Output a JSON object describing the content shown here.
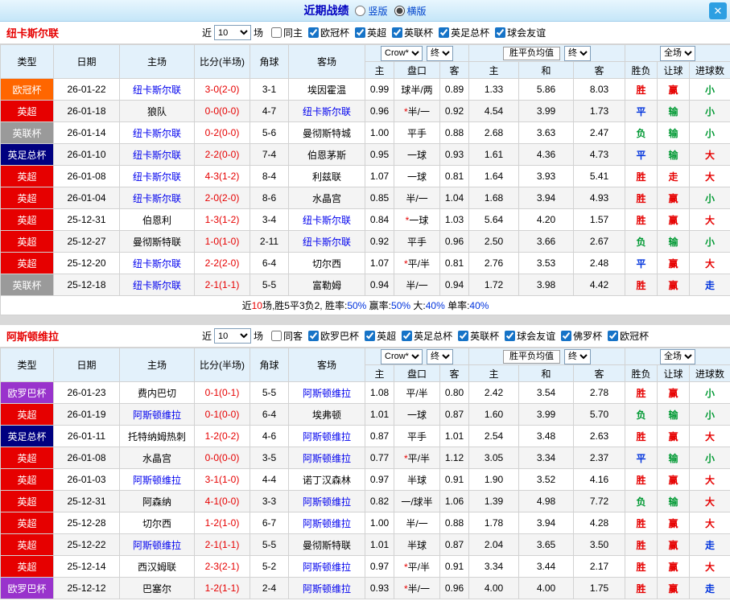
{
  "topbar": {
    "title": "近期战绩",
    "layout_options": [
      {
        "label": "竖版",
        "selected": false
      },
      {
        "label": "横版",
        "selected": true
      }
    ],
    "close": "✕"
  },
  "table_headers": {
    "type": "类型",
    "date": "日期",
    "home": "主场",
    "score": "比分(半场)",
    "corner": "角球",
    "away": "客场",
    "odds_home": "主",
    "handicap": "盘口",
    "odds_away": "客",
    "avg_win": "主",
    "avg_draw": "和",
    "avg_lose": "客",
    "result": "胜负",
    "handicap_result": "让球",
    "goals_result": "进球数"
  },
  "controls": {
    "odds_source": "Crow*",
    "final_label": "终",
    "avg_label": "胜平负均值",
    "scope": "全场"
  },
  "league_colors": {
    "欧冠杯": "#ff6600",
    "英超": "#e60000",
    "英联杯": "#9a9a9a",
    "英足总杯": "#000080",
    "欧罗巴杯": "#9933cc"
  },
  "result_palette": {
    "red": "#e60000",
    "blue": "#0033dd",
    "green": "#009933"
  },
  "sections": [
    {
      "team": "纽卡斯尔联",
      "team_color": "#e60000",
      "filter": {
        "near_label": "近",
        "match_count": "10",
        "games_label": "场",
        "same_label": "同主",
        "same_checked": false,
        "leagues": [
          "欧冠杯",
          "英超",
          "英联杯",
          "英足总杯",
          "球会友谊"
        ]
      },
      "rows": [
        {
          "league": "欧冠杯",
          "date": "26-01-22",
          "home": "纽卡斯尔联",
          "home_is_team": true,
          "score": "3-0(2-0)",
          "corner": "3-1",
          "away": "埃因霍温",
          "away_is_team": false,
          "odds_home": "0.99",
          "handicap": "球半/两",
          "odds_away": "0.89",
          "avg_win": "1.33",
          "avg_draw": "5.86",
          "avg_lose": "8.03",
          "result": {
            "t": "胜",
            "c": "red"
          },
          "handicap_result": {
            "t": "赢",
            "c": "red"
          },
          "goals_result": {
            "t": "小",
            "c": "green"
          }
        },
        {
          "league": "英超",
          "date": "26-01-18",
          "home": "狼队",
          "home_is_team": false,
          "score": "0-0(0-0)",
          "corner": "4-7",
          "away": "纽卡斯尔联",
          "away_is_team": true,
          "odds_home": "0.96",
          "handicap": "*半/一",
          "odds_away": "0.92",
          "avg_win": "4.54",
          "avg_draw": "3.99",
          "avg_lose": "1.73",
          "result": {
            "t": "平",
            "c": "blue"
          },
          "handicap_result": {
            "t": "输",
            "c": "green"
          },
          "goals_result": {
            "t": "小",
            "c": "green"
          }
        },
        {
          "league": "英联杯",
          "date": "26-01-14",
          "home": "纽卡斯尔联",
          "home_is_team": true,
          "score": "0-2(0-0)",
          "corner": "5-6",
          "away": "曼彻斯特城",
          "away_is_team": false,
          "odds_home": "1.00",
          "handicap": "平手",
          "odds_away": "0.88",
          "avg_win": "2.68",
          "avg_draw": "3.63",
          "avg_lose": "2.47",
          "result": {
            "t": "负",
            "c": "green"
          },
          "handicap_result": {
            "t": "输",
            "c": "green"
          },
          "goals_result": {
            "t": "小",
            "c": "green"
          }
        },
        {
          "league": "英足总杯",
          "date": "26-01-10",
          "home": "纽卡斯尔联",
          "home_is_team": true,
          "score": "2-2(0-0)",
          "corner": "7-4",
          "away": "伯恩茅斯",
          "away_is_team": false,
          "odds_home": "0.95",
          "handicap": "一球",
          "odds_away": "0.93",
          "avg_win": "1.61",
          "avg_draw": "4.36",
          "avg_lose": "4.73",
          "result": {
            "t": "平",
            "c": "blue"
          },
          "handicap_result": {
            "t": "输",
            "c": "green"
          },
          "goals_result": {
            "t": "大",
            "c": "red"
          }
        },
        {
          "league": "英超",
          "date": "26-01-08",
          "home": "纽卡斯尔联",
          "home_is_team": true,
          "score": "4-3(1-2)",
          "corner": "8-4",
          "away": "利兹联",
          "away_is_team": false,
          "odds_home": "1.07",
          "handicap": "一球",
          "odds_away": "0.81",
          "avg_win": "1.64",
          "avg_draw": "3.93",
          "avg_lose": "5.41",
          "result": {
            "t": "胜",
            "c": "red"
          },
          "handicap_result": {
            "t": "走",
            "c": "red"
          },
          "goals_result": {
            "t": "大",
            "c": "red"
          }
        },
        {
          "league": "英超",
          "date": "26-01-04",
          "home": "纽卡斯尔联",
          "home_is_team": true,
          "score": "2-0(2-0)",
          "corner": "8-6",
          "away": "水晶宫",
          "away_is_team": false,
          "odds_home": "0.85",
          "handicap": "半/一",
          "odds_away": "1.04",
          "avg_win": "1.68",
          "avg_draw": "3.94",
          "avg_lose": "4.93",
          "result": {
            "t": "胜",
            "c": "red"
          },
          "handicap_result": {
            "t": "赢",
            "c": "red"
          },
          "goals_result": {
            "t": "小",
            "c": "green"
          }
        },
        {
          "league": "英超",
          "date": "25-12-31",
          "home": "伯恩利",
          "home_is_team": false,
          "score": "1-3(1-2)",
          "corner": "3-4",
          "away": "纽卡斯尔联",
          "away_is_team": true,
          "odds_home": "0.84",
          "handicap": "*一球",
          "odds_away": "1.03",
          "avg_win": "5.64",
          "avg_draw": "4.20",
          "avg_lose": "1.57",
          "result": {
            "t": "胜",
            "c": "red"
          },
          "handicap_result": {
            "t": "赢",
            "c": "red"
          },
          "goals_result": {
            "t": "大",
            "c": "red"
          }
        },
        {
          "league": "英超",
          "date": "25-12-27",
          "home": "曼彻斯特联",
          "home_is_team": false,
          "score": "1-0(1-0)",
          "corner": "2-11",
          "away": "纽卡斯尔联",
          "away_is_team": true,
          "odds_home": "0.92",
          "handicap": "平手",
          "odds_away": "0.96",
          "avg_win": "2.50",
          "avg_draw": "3.66",
          "avg_lose": "2.67",
          "result": {
            "t": "负",
            "c": "green"
          },
          "handicap_result": {
            "t": "输",
            "c": "green"
          },
          "goals_result": {
            "t": "小",
            "c": "green"
          }
        },
        {
          "league": "英超",
          "date": "25-12-20",
          "home": "纽卡斯尔联",
          "home_is_team": true,
          "score": "2-2(2-0)",
          "corner": "6-4",
          "away": "切尔西",
          "away_is_team": false,
          "odds_home": "1.07",
          "handicap": "*平/半",
          "odds_away": "0.81",
          "avg_win": "2.76",
          "avg_draw": "3.53",
          "avg_lose": "2.48",
          "result": {
            "t": "平",
            "c": "blue"
          },
          "handicap_result": {
            "t": "赢",
            "c": "red"
          },
          "goals_result": {
            "t": "大",
            "c": "red"
          }
        },
        {
          "league": "英联杯",
          "date": "25-12-18",
          "home": "纽卡斯尔联",
          "home_is_team": true,
          "score": "2-1(1-1)",
          "corner": "5-5",
          "away": "富勒姆",
          "away_is_team": false,
          "odds_home": "0.94",
          "handicap": "半/一",
          "odds_away": "0.94",
          "avg_win": "1.72",
          "avg_draw": "3.98",
          "avg_lose": "4.42",
          "result": {
            "t": "胜",
            "c": "red"
          },
          "handicap_result": {
            "t": "赢",
            "c": "red"
          },
          "goals_result": {
            "t": "走",
            "c": "blue"
          }
        }
      ],
      "summary": [
        {
          "t": "近",
          "c": "k"
        },
        {
          "t": "10",
          "c": "r"
        },
        {
          "t": "场,胜5平3负2, 胜率:",
          "c": "k"
        },
        {
          "t": "50%",
          "c": "b"
        },
        {
          "t": " 赢率:",
          "c": "k"
        },
        {
          "t": "50%",
          "c": "b"
        },
        {
          "t": " 大:",
          "c": "k"
        },
        {
          "t": "40%",
          "c": "b"
        },
        {
          "t": " 单率:",
          "c": "k"
        },
        {
          "t": "40%",
          "c": "b"
        }
      ]
    },
    {
      "team": "阿斯顿维拉",
      "team_color": "#e60000",
      "filter": {
        "near_label": "近",
        "match_count": "10",
        "games_label": "场",
        "same_label": "同客",
        "same_checked": false,
        "leagues": [
          "欧罗巴杯",
          "英超",
          "英足总杯",
          "英联杯",
          "球会友谊",
          "佛罗杯",
          "欧冠杯"
        ]
      },
      "rows": [
        {
          "league": "欧罗巴杯",
          "date": "26-01-23",
          "home": "费内巴切",
          "home_is_team": false,
          "score": "0-1(0-1)",
          "corner": "5-5",
          "away": "阿斯顿维拉",
          "away_is_team": true,
          "odds_home": "1.08",
          "handicap": "平/半",
          "odds_away": "0.80",
          "avg_win": "2.42",
          "avg_draw": "3.54",
          "avg_lose": "2.78",
          "result": {
            "t": "胜",
            "c": "red"
          },
          "handicap_result": {
            "t": "赢",
            "c": "red"
          },
          "goals_result": {
            "t": "小",
            "c": "green"
          }
        },
        {
          "league": "英超",
          "date": "26-01-19",
          "home": "阿斯顿维拉",
          "home_is_team": true,
          "score": "0-1(0-0)",
          "corner": "6-4",
          "away": "埃弗顿",
          "away_is_team": false,
          "odds_home": "1.01",
          "handicap": "一球",
          "odds_away": "0.87",
          "avg_win": "1.60",
          "avg_draw": "3.99",
          "avg_lose": "5.70",
          "result": {
            "t": "负",
            "c": "green"
          },
          "handicap_result": {
            "t": "输",
            "c": "green"
          },
          "goals_result": {
            "t": "小",
            "c": "green"
          }
        },
        {
          "league": "英足总杯",
          "date": "26-01-11",
          "home": "托特纳姆热刺",
          "home_is_team": false,
          "score": "1-2(0-2)",
          "corner": "4-6",
          "away": "阿斯顿维拉",
          "away_is_team": true,
          "odds_home": "0.87",
          "handicap": "平手",
          "odds_away": "1.01",
          "avg_win": "2.54",
          "avg_draw": "3.48",
          "avg_lose": "2.63",
          "result": {
            "t": "胜",
            "c": "red"
          },
          "handicap_result": {
            "t": "赢",
            "c": "red"
          },
          "goals_result": {
            "t": "大",
            "c": "red"
          }
        },
        {
          "league": "英超",
          "date": "26-01-08",
          "home": "水晶宫",
          "home_is_team": false,
          "score": "0-0(0-0)",
          "corner": "3-5",
          "away": "阿斯顿维拉",
          "away_is_team": true,
          "odds_home": "0.77",
          "handicap": "*平/半",
          "odds_away": "1.12",
          "avg_win": "3.05",
          "avg_draw": "3.34",
          "avg_lose": "2.37",
          "result": {
            "t": "平",
            "c": "blue"
          },
          "handicap_result": {
            "t": "输",
            "c": "green"
          },
          "goals_result": {
            "t": "小",
            "c": "green"
          }
        },
        {
          "league": "英超",
          "date": "26-01-03",
          "home": "阿斯顿维拉",
          "home_is_team": true,
          "score": "3-1(1-0)",
          "corner": "4-4",
          "away": "诺丁汉森林",
          "away_is_team": false,
          "odds_home": "0.97",
          "handicap": "半球",
          "odds_away": "0.91",
          "avg_win": "1.90",
          "avg_draw": "3.52",
          "avg_lose": "4.16",
          "result": {
            "t": "胜",
            "c": "red"
          },
          "handicap_result": {
            "t": "赢",
            "c": "red"
          },
          "goals_result": {
            "t": "大",
            "c": "red"
          }
        },
        {
          "league": "英超",
          "date": "25-12-31",
          "home": "阿森纳",
          "home_is_team": false,
          "score": "4-1(0-0)",
          "corner": "3-3",
          "away": "阿斯顿维拉",
          "away_is_team": true,
          "odds_home": "0.82",
          "handicap": "一/球半",
          "odds_away": "1.06",
          "avg_win": "1.39",
          "avg_draw": "4.98",
          "avg_lose": "7.72",
          "result": {
            "t": "负",
            "c": "green"
          },
          "handicap_result": {
            "t": "输",
            "c": "green"
          },
          "goals_result": {
            "t": "大",
            "c": "red"
          }
        },
        {
          "league": "英超",
          "date": "25-12-28",
          "home": "切尔西",
          "home_is_team": false,
          "score": "1-2(1-0)",
          "corner": "6-7",
          "away": "阿斯顿维拉",
          "away_is_team": true,
          "odds_home": "1.00",
          "handicap": "半/一",
          "odds_away": "0.88",
          "avg_win": "1.78",
          "avg_draw": "3.94",
          "avg_lose": "4.28",
          "result": {
            "t": "胜",
            "c": "red"
          },
          "handicap_result": {
            "t": "赢",
            "c": "red"
          },
          "goals_result": {
            "t": "大",
            "c": "red"
          }
        },
        {
          "league": "英超",
          "date": "25-12-22",
          "home": "阿斯顿维拉",
          "home_is_team": true,
          "score": "2-1(1-1)",
          "corner": "5-5",
          "away": "曼彻斯特联",
          "away_is_team": false,
          "odds_home": "1.01",
          "handicap": "半球",
          "odds_away": "0.87",
          "avg_win": "2.04",
          "avg_draw": "3.65",
          "avg_lose": "3.50",
          "result": {
            "t": "胜",
            "c": "red"
          },
          "handicap_result": {
            "t": "赢",
            "c": "red"
          },
          "goals_result": {
            "t": "走",
            "c": "blue"
          }
        },
        {
          "league": "英超",
          "date": "25-12-14",
          "home": "西汉姆联",
          "home_is_team": false,
          "score": "2-3(2-1)",
          "corner": "5-2",
          "away": "阿斯顿维拉",
          "away_is_team": true,
          "odds_home": "0.97",
          "handicap": "*平/半",
          "odds_away": "0.91",
          "avg_win": "3.34",
          "avg_draw": "3.44",
          "avg_lose": "2.17",
          "result": {
            "t": "胜",
            "c": "red"
          },
          "handicap_result": {
            "t": "赢",
            "c": "red"
          },
          "goals_result": {
            "t": "大",
            "c": "red"
          }
        },
        {
          "league": "欧罗巴杯",
          "date": "25-12-12",
          "home": "巴塞尔",
          "home_is_team": false,
          "score": "1-2(1-1)",
          "corner": "2-4",
          "away": "阿斯顿维拉",
          "away_is_team": true,
          "odds_home": "0.93",
          "handicap": "*半/一",
          "odds_away": "0.96",
          "avg_win": "4.00",
          "avg_draw": "4.00",
          "avg_lose": "1.75",
          "result": {
            "t": "胜",
            "c": "red"
          },
          "handicap_result": {
            "t": "赢",
            "c": "red"
          },
          "goals_result": {
            "t": "走",
            "c": "blue"
          }
        }
      ],
      "summary": null
    }
  ]
}
